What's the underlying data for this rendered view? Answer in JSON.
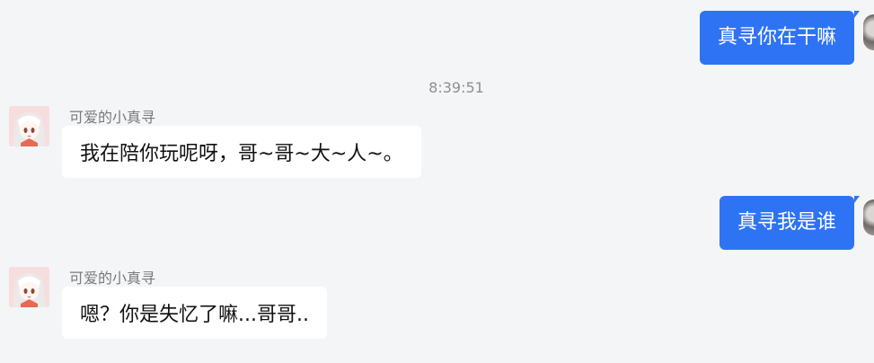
{
  "conversation": {
    "timestamp": "8:39:51",
    "messages": [
      {
        "sender": "self",
        "text": "真寻你在干嘛"
      },
      {
        "sender": "assistant",
        "name": "可爱的小真寻",
        "text": "我在陪你玩呢呀，哥~哥~大~人~。"
      },
      {
        "sender": "self",
        "text": "真寻我是谁"
      },
      {
        "sender": "assistant",
        "name": "可爱的小真寻",
        "text": "嗯？你是失忆了嘛...哥哥.."
      }
    ]
  }
}
